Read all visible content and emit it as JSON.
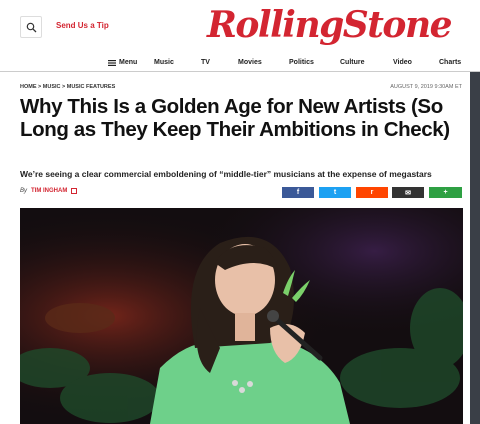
{
  "header": {
    "send_tip": "Send Us a Tip",
    "logo": "RollingStone"
  },
  "nav": {
    "menu_label": "Menu",
    "items": [
      "Music",
      "TV",
      "Movies",
      "Politics",
      "Culture",
      "Video",
      "Charts"
    ]
  },
  "article": {
    "breadcrumb": "HOME > MUSIC > MUSIC FEATURES",
    "date": "AUGUST 9, 2019 9:30AM ET",
    "headline": "Why This Is a Golden Age for New Artists (So Long as They Keep Their Ambitions in Check)",
    "dek": "We’re seeing a clear commercial emboldening of “middle-tier” musicians at the expense of megastars",
    "by": "By",
    "author": "TIM INGHAM"
  },
  "share": {
    "facebook": {
      "glyph": "f",
      "color": "#3b5998"
    },
    "twitter": {
      "glyph": "t",
      "color": "#1da1f2"
    },
    "reddit": {
      "glyph": "r",
      "color": "#ff4500"
    },
    "email": {
      "glyph": "✉",
      "color": "#333333"
    },
    "more": {
      "glyph": "+",
      "color": "#2ea043"
    }
  },
  "colors": {
    "brand": "#d32531",
    "nav_text": "#222222"
  }
}
